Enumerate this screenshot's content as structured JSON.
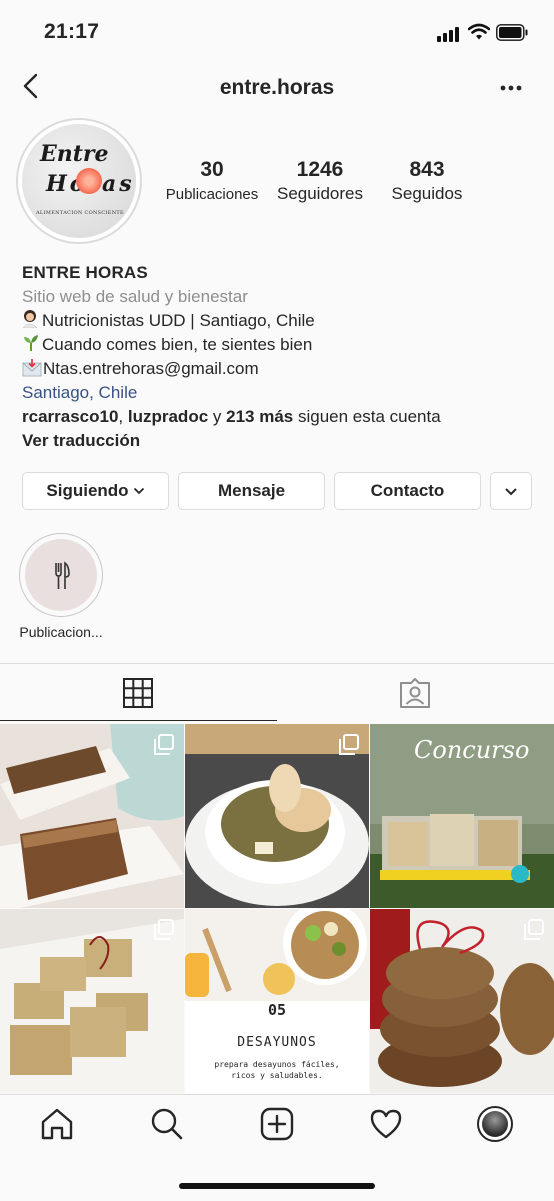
{
  "status_bar": {
    "time": "21:17"
  },
  "header": {
    "username": "entre.horas"
  },
  "avatar": {
    "logo_text_line1": "Entre",
    "logo_text_line2": "Horas",
    "logo_tagline": "ALIMENTACION CONSCIENTE"
  },
  "stats": [
    {
      "value": "30",
      "label": "Publicaciones"
    },
    {
      "value": "1246",
      "label": "Seguidores"
    },
    {
      "value": "843",
      "label": "Seguidos"
    }
  ],
  "bio": {
    "name": "ENTRE HORAS",
    "category": "Sitio web de salud y bienestar",
    "line1": "Nutricionistas UDD | Santiago, Chile",
    "line2": "Cuando comes bien, te sientes bien",
    "line3": "Ntas.entrehoras@gmail.com",
    "location": "Santiago, Chile",
    "followers_user1": "rcarrasco10",
    "followers_sep": ", ",
    "followers_user2": "luzpradoc",
    "followers_and": " y ",
    "followers_more": "213 más",
    "followers_suffix": " siguen esta cuenta",
    "translate": "Ver traducción"
  },
  "buttons": {
    "following": "Siguiendo",
    "message": "Mensaje",
    "contact": "Contacto"
  },
  "highlight": {
    "label": "Publicacion..."
  },
  "posts": [
    {
      "kind": "photo"
    },
    {
      "kind": "photo"
    },
    {
      "kind": "photo",
      "overlay_text": "Concurso"
    },
    {
      "kind": "photo"
    },
    {
      "kind": "photo",
      "number": "05",
      "title": "DESAYUNOS",
      "caption": "prepara desayunos fáciles, ricos y saludables."
    },
    {
      "kind": "photo"
    }
  ],
  "colors": {
    "link": "#385185",
    "secondary_text": "#8e8e8e",
    "border": "#dbdbdb"
  },
  "icons": [
    "back-icon",
    "more-icon",
    "grid-icon",
    "tagged-icon",
    "home-icon",
    "search-icon",
    "add-icon",
    "heart-icon",
    "profile-icon"
  ]
}
